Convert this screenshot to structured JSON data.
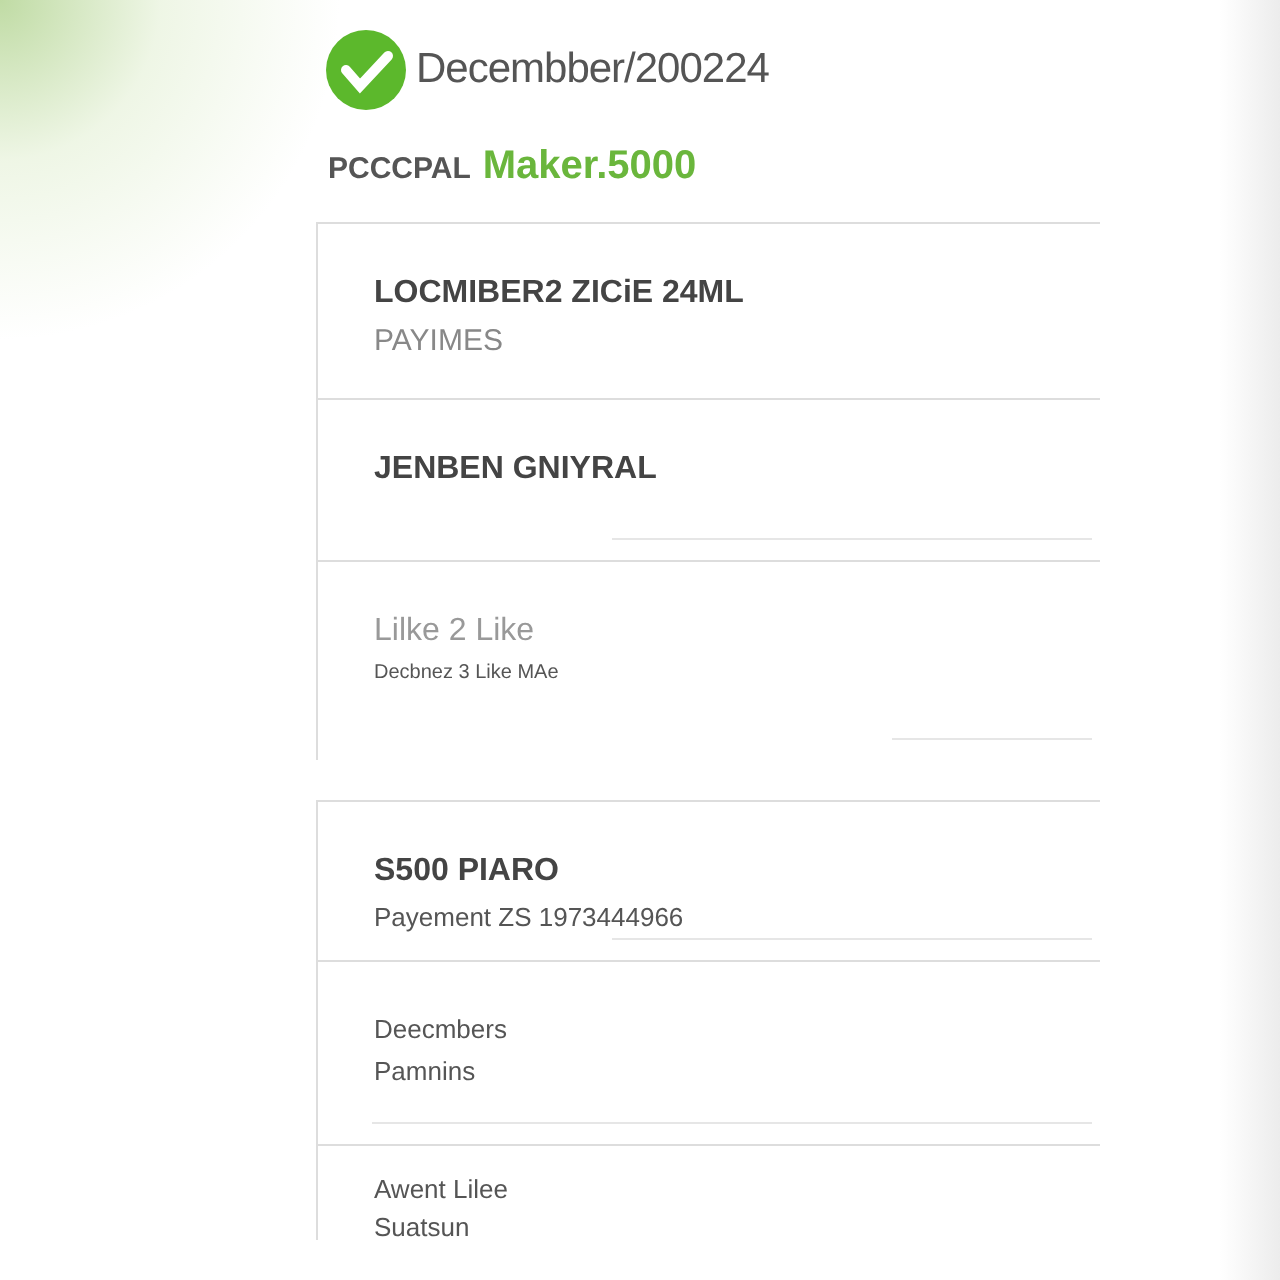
{
  "header": {
    "title": "Decembber/200224",
    "label": "PCCCPAL",
    "amount": "Maker.5000"
  },
  "groups": [
    {
      "sections": [
        {
          "lines": [
            {
              "kind": "heading",
              "text": "LOCMIBER2 ZICiE 24ML"
            },
            {
              "kind": "caption",
              "text": "PAYIMES"
            }
          ]
        },
        {
          "lines": [
            {
              "kind": "heading",
              "text": "JENBEN GNIYRAL"
            }
          ]
        },
        {
          "lines": [
            {
              "kind": "light",
              "text": "Lilke 2 Like"
            },
            {
              "kind": "small",
              "text": "Decbnez 3 Like MAe"
            }
          ]
        }
      ]
    },
    {
      "sections": [
        {
          "lines": [
            {
              "kind": "heading",
              "text": "S500 PIARO"
            },
            {
              "kind": "body",
              "text": "Payement ZS 1973444966"
            }
          ]
        },
        {
          "lines": [
            {
              "kind": "body",
              "text": "Deecmbers"
            },
            {
              "kind": "body",
              "text": "Pamnins"
            }
          ]
        },
        {
          "lines": [
            {
              "kind": "body",
              "text": "Awent Lilee"
            },
            {
              "kind": "body",
              "text": "Suatsun"
            }
          ]
        }
      ]
    }
  ]
}
